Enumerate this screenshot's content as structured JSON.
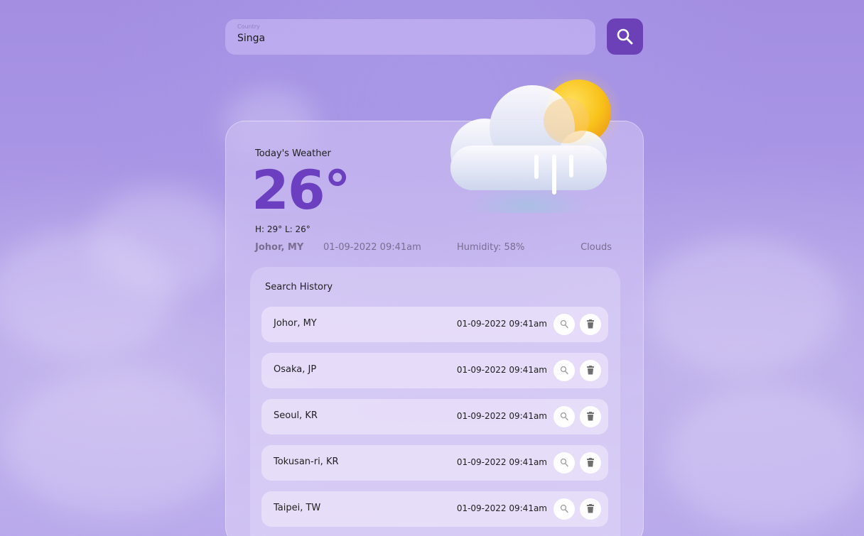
{
  "search": {
    "label": "Country",
    "value": "Singa"
  },
  "today": {
    "label": "Today's Weather",
    "temperature": "26°",
    "high_low": "H: 29° L: 26°",
    "location": "Johor, MY",
    "datetime": "01-09-2022 09:41am",
    "humidity": "Humidity: 58%",
    "condition": "Clouds"
  },
  "history": {
    "title": "Search History",
    "items": [
      {
        "city": "Johor, MY",
        "time": "01-09-2022 09:41am"
      },
      {
        "city": "Osaka, JP",
        "time": "01-09-2022 09:41am"
      },
      {
        "city": "Seoul, KR",
        "time": "01-09-2022 09:41am"
      },
      {
        "city": "Tokusan-ri, KR",
        "time": "01-09-2022 09:41am"
      },
      {
        "city": "Taipei, TW",
        "time": "01-09-2022 09:41am"
      }
    ]
  },
  "icons": {
    "search": "search-icon",
    "delete": "trash-icon",
    "weather": "cloud-sun-rain-icon"
  },
  "colors": {
    "accent": "#6c41b8",
    "temperature": "#6b3fbf",
    "background": "#a38ee2"
  }
}
